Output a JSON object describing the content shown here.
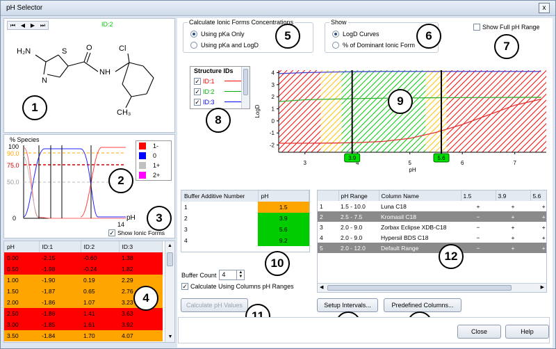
{
  "window": {
    "title": "pH Selector",
    "close_label": "x"
  },
  "badges": [
    "1",
    "2",
    "3",
    "4",
    "5",
    "6",
    "7",
    "8",
    "9",
    "10",
    "11",
    "12",
    "13",
    "14"
  ],
  "navigator": {
    "first": "⏮",
    "prev": "◀",
    "next": "▶",
    "last": "⏭",
    "current_id": "ID:2"
  },
  "structure": {
    "atoms": {
      "nh2": "H₂N",
      "s": "S",
      "n": "N",
      "o": "O",
      "nh": "NH",
      "cl": "Cl",
      "ch3": "CH₃"
    }
  },
  "species_plot": {
    "title": "% Species",
    "y_labels": [
      "100",
      "90.0",
      "75.0",
      "50.0",
      "0"
    ],
    "x_label": "pH",
    "x_max": "14",
    "legend": [
      {
        "label": "1-",
        "color": "#ff0000"
      },
      {
        "label": "0",
        "color": "#0000ff"
      },
      {
        "label": "1+",
        "color": "#c0c0c0"
      },
      {
        "label": "2+",
        "color": "#ff00ff"
      }
    ],
    "show_ionic_label": "Show Ionic Forms"
  },
  "ph_table": {
    "headers": [
      "pH",
      "ID:1",
      "ID:2",
      "ID:3"
    ],
    "rows": [
      {
        "cells": [
          "0.00",
          "-2.15",
          "-0.60",
          "1.38"
        ],
        "cls": "r0"
      },
      {
        "cells": [
          "0.50",
          "-1.98",
          "-0.24",
          "1.82"
        ],
        "cls": "r0"
      },
      {
        "cells": [
          "1.00",
          "-1.90",
          "0.19",
          "2.29"
        ],
        "cls": "r1"
      },
      {
        "cells": [
          "1.50",
          "-1.87",
          "0.65",
          "2.76"
        ],
        "cls": "r1"
      },
      {
        "cells": [
          "2.00",
          "-1.86",
          "1.07",
          "3.23"
        ],
        "cls": "r1"
      },
      {
        "cells": [
          "2.50",
          "-1.86",
          "1.41",
          "3.63"
        ],
        "cls": "r0"
      },
      {
        "cells": [
          "3.00",
          "-1.85",
          "1.61",
          "3.92"
        ],
        "cls": "r0"
      },
      {
        "cells": [
          "3.50",
          "-1.84",
          "1.70",
          "4.07"
        ],
        "cls": "r1"
      }
    ]
  },
  "calc_group": {
    "title": "Calculate Ionic Forms Concentrations",
    "opt1": "Using pKa Only",
    "opt2": "Using pKa and LogD"
  },
  "show_group": {
    "title": "Show",
    "opt1": "LogD Curves",
    "opt2": "% of Dominant Ionic Form"
  },
  "full_range_label": "Show Full pH Range",
  "structure_ids": {
    "title": "Structure IDs",
    "items": [
      {
        "label": "ID:1",
        "color": "#ff0000"
      },
      {
        "label": "ID:2",
        "color": "#00b000"
      },
      {
        "label": "ID:3",
        "color": "#0000ff"
      }
    ]
  },
  "chart_data": {
    "type": "line",
    "xlabel": "pH",
    "ylabel": "LogD",
    "xlim": [
      2.5,
      7.6
    ],
    "ylim": [
      -2.6,
      4.2
    ],
    "x_ticks": [
      "3",
      "4",
      "5",
      "6",
      "7"
    ],
    "y_ticks": [
      "4",
      "3",
      "2",
      "1",
      "0",
      "-1",
      "-2"
    ],
    "series": [
      {
        "name": "ID:1",
        "color": "#e03030",
        "x": [
          2.5,
          3.0,
          3.5,
          4.0,
          4.5,
          5.0,
          5.5,
          6.0,
          6.5,
          7.0,
          7.5
        ],
        "y": [
          -1.85,
          -1.85,
          -1.84,
          -1.8,
          -1.7,
          -1.45,
          -0.95,
          -0.3,
          0.5,
          1.3,
          1.8
        ]
      },
      {
        "name": "ID:2",
        "color": "#30b030",
        "x": [
          2.5,
          3.0,
          3.5,
          4.0,
          4.5,
          5.0,
          5.5,
          6.0,
          6.5,
          7.0,
          7.5
        ],
        "y": [
          1.6,
          1.75,
          1.8,
          1.85,
          1.88,
          1.9,
          1.92,
          1.93,
          1.94,
          1.95,
          1.95
        ]
      },
      {
        "name": "ID:3",
        "color": "#4040d0",
        "x": [
          2.5,
          3.0,
          3.5,
          4.0,
          4.5,
          5.0,
          5.5,
          6.0,
          6.5,
          7.0,
          7.5
        ],
        "y": [
          3.92,
          4.0,
          4.05,
          4.08,
          4.1,
          4.1,
          4.1,
          4.1,
          4.1,
          4.1,
          4.1
        ]
      }
    ],
    "regions": [
      {
        "x0": 2.5,
        "x1": 3.3,
        "color": "#ff0000"
      },
      {
        "x0": 3.3,
        "x1": 3.7,
        "color": "#ffc000"
      },
      {
        "x0": 3.7,
        "x1": 5.3,
        "color": "#00cc00"
      },
      {
        "x0": 5.3,
        "x1": 5.7,
        "color": "#ffc000"
      },
      {
        "x0": 5.7,
        "x1": 7.6,
        "color": "#ff0000"
      }
    ],
    "markers": [
      {
        "x": 3.9,
        "label": "3.9"
      },
      {
        "x": 5.6,
        "label": "5.6"
      }
    ]
  },
  "buffer_table": {
    "headers": [
      "Buffer Additive Number",
      "pH"
    ],
    "rows": [
      {
        "n": "1",
        "ph": "1.5",
        "cls": "r1"
      },
      {
        "n": "2",
        "ph": "3.9",
        "cls": "r3"
      },
      {
        "n": "3",
        "ph": "5.6",
        "cls": "r3"
      },
      {
        "n": "4",
        "ph": "9.2",
        "cls": "r3"
      }
    ]
  },
  "buffer_count": {
    "label": "Buffer Count",
    "value": "4"
  },
  "use_columns_label": "Calculate Using Columns pH Ranges",
  "calc_ph_button": "Calculate pH Values",
  "columns_table": {
    "headers": [
      "",
      "pH Range",
      "Column Name",
      "1.5",
      "3.9",
      "5.6"
    ],
    "rows": [
      {
        "cells": [
          "1",
          "1.5 - 10.0",
          "Luna C18",
          "+",
          "+",
          "+"
        ],
        "sel": false
      },
      {
        "cells": [
          "2",
          "2.5 - 7.5",
          "Kromasil C18",
          "−",
          "+",
          "+"
        ],
        "sel": true
      },
      {
        "cells": [
          "3",
          "2.0 - 9.0",
          "Zorbax Eclipse XDB-C18",
          "−",
          "+",
          "+"
        ],
        "sel": false
      },
      {
        "cells": [
          "4",
          "2.0 - 9.0",
          "Hypersil BDS C18",
          "−",
          "+",
          "+"
        ],
        "sel": false
      },
      {
        "cells": [
          "5",
          "2.0 - 12.0",
          "Default Range",
          "−",
          "+",
          "+"
        ],
        "sel": true
      }
    ]
  },
  "setup_button": "Setup Intervals...",
  "predefined_button": "Predefined Columns...",
  "close_button": "Close",
  "help_button": "Help"
}
